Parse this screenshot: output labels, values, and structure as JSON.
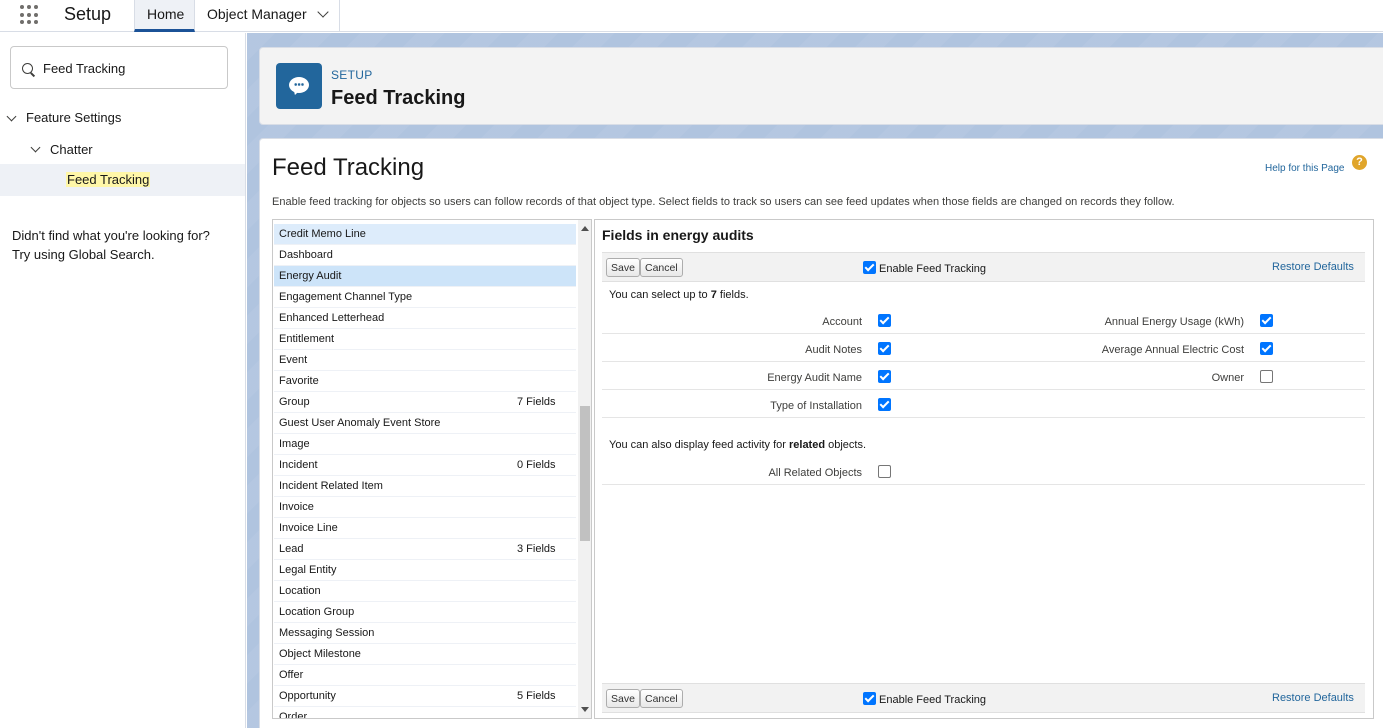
{
  "app": {
    "name": "Setup"
  },
  "nav": {
    "home": "Home",
    "object_manager": "Object Manager"
  },
  "sidebar": {
    "search_value": "Feed Tracking",
    "tree": {
      "feature_settings": "Feature Settings",
      "chatter": "Chatter",
      "feed_tracking": "Feed Tracking"
    },
    "help_line1": "Didn't find what you're looking for?",
    "help_line2": "Try using Global Search."
  },
  "header": {
    "setup_label": "SETUP",
    "title": "Feed Tracking"
  },
  "content": {
    "title": "Feed Tracking",
    "help_link": "Help for this Page",
    "help_icon": "?",
    "intro": "Enable feed tracking for objects so users can follow records of that object type. Select fields to track so users can see feed updates when those fields are changed on records they follow."
  },
  "objects": [
    {
      "name": "Credit Memo Line",
      "count": ""
    },
    {
      "name": "Dashboard",
      "count": ""
    },
    {
      "name": "Energy Audit",
      "count": ""
    },
    {
      "name": "Engagement Channel Type",
      "count": ""
    },
    {
      "name": "Enhanced Letterhead",
      "count": ""
    },
    {
      "name": "Entitlement",
      "count": ""
    },
    {
      "name": "Event",
      "count": ""
    },
    {
      "name": "Favorite",
      "count": ""
    },
    {
      "name": "Group",
      "count": "7 Fields"
    },
    {
      "name": "Guest User Anomaly Event Store",
      "count": ""
    },
    {
      "name": "Image",
      "count": ""
    },
    {
      "name": "Incident",
      "count": "0 Fields"
    },
    {
      "name": "Incident Related Item",
      "count": ""
    },
    {
      "name": "Invoice",
      "count": ""
    },
    {
      "name": "Invoice Line",
      "count": ""
    },
    {
      "name": "Lead",
      "count": "3 Fields"
    },
    {
      "name": "Legal Entity",
      "count": ""
    },
    {
      "name": "Location",
      "count": ""
    },
    {
      "name": "Location Group",
      "count": ""
    },
    {
      "name": "Messaging Session",
      "count": ""
    },
    {
      "name": "Object Milestone",
      "count": ""
    },
    {
      "name": "Offer",
      "count": ""
    },
    {
      "name": "Opportunity",
      "count": "5 Fields"
    },
    {
      "name": "Order",
      "count": ""
    }
  ],
  "fields_panel": {
    "title": "Fields in energy audits",
    "save": "Save",
    "cancel": "Cancel",
    "enable_label": "Enable Feed Tracking",
    "enable_checked": true,
    "restore": "Restore Defaults",
    "select_note_pre": "You can select up to ",
    "select_note_num": "7",
    "select_note_post": " fields.",
    "fields": [
      {
        "left": "Account",
        "left_checked": true,
        "right": "Annual Energy Usage (kWh)",
        "right_checked": true
      },
      {
        "left": "Audit Notes",
        "left_checked": true,
        "right": "Average Annual Electric Cost",
        "right_checked": true
      },
      {
        "left": "Energy Audit Name",
        "left_checked": true,
        "right": "Owner",
        "right_checked": false
      },
      {
        "left": "Type of Installation",
        "left_checked": true,
        "right": "",
        "right_checked": null
      }
    ],
    "related_note_pre": "You can also display feed activity for ",
    "related_note_bold": "related",
    "related_note_post": " objects.",
    "all_related": "All Related Objects",
    "all_related_checked": false
  }
}
